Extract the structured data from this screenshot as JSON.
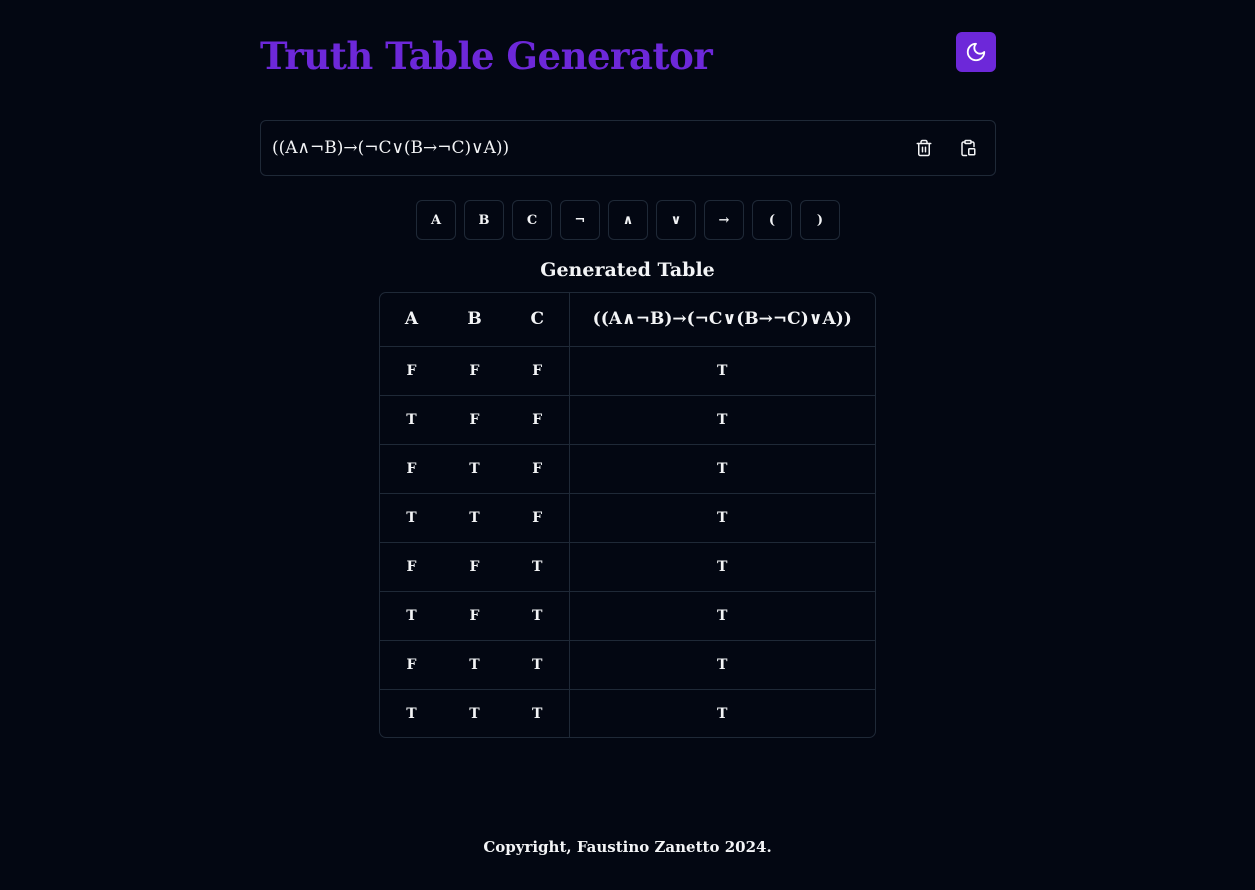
{
  "header": {
    "title": "Truth Table Generator",
    "theme_icon": "moon-icon",
    "accent_color": "#6d28d9"
  },
  "input": {
    "value": "((A∧¬B)→(¬C∨(B→¬C)∨A))",
    "clear_icon": "trash-icon",
    "copy_icon": "clipboard-copy-icon"
  },
  "keypad": {
    "keys": [
      "A",
      "B",
      "C",
      "¬",
      "∧",
      "∨",
      "→",
      "(",
      ")"
    ]
  },
  "table": {
    "title": "Generated Table",
    "headers": [
      "A",
      "B",
      "C",
      "((A∧¬B)→(¬C∨(B→¬C)∨A))"
    ],
    "rows": [
      [
        "F",
        "F",
        "F",
        "T"
      ],
      [
        "T",
        "F",
        "F",
        "T"
      ],
      [
        "F",
        "T",
        "F",
        "T"
      ],
      [
        "T",
        "T",
        "F",
        "T"
      ],
      [
        "F",
        "F",
        "T",
        "T"
      ],
      [
        "T",
        "F",
        "T",
        "T"
      ],
      [
        "F",
        "T",
        "T",
        "T"
      ],
      [
        "T",
        "T",
        "T",
        "T"
      ]
    ]
  },
  "footer": {
    "text": "Copyright, Faustino Zanetto 2024."
  }
}
